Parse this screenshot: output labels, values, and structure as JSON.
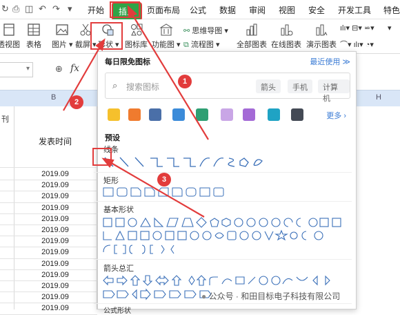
{
  "menu_tabs": [
    "开始",
    "插入",
    "页面布局",
    "公式",
    "数据",
    "审阅",
    "视图",
    "安全",
    "开发工具",
    "特色"
  ],
  "ribbon": {
    "left_cut": "透视图",
    "table": "表格",
    "picture": "图片",
    "screenshot": "截屏",
    "shape": "形状",
    "icon_lib": "图标库",
    "func_chart": "功能图",
    "mindmap": "思维导图",
    "flowchart": "流程图",
    "all_charts": "全部图表",
    "online_charts": "在线图表",
    "demo_charts": "演示图表"
  },
  "formula": {
    "fx": "fx"
  },
  "sheet": {
    "col_b": "B",
    "col_h": "H",
    "left_text": "刊",
    "header_cell": "发表时间",
    "dates": [
      "2019.09",
      "2019.09",
      "2019.09",
      "2019.09",
      "2019.09",
      "2019.09",
      "2019.09",
      "2019.09",
      "2019.09",
      "2019.09",
      "2019.09",
      "2019.09",
      "2019.09"
    ]
  },
  "dialog": {
    "title": "每日限免图标",
    "recent": "最近使用",
    "search_placeholder": "搜索图标",
    "chips": [
      "箭头",
      "手机",
      "计算机"
    ],
    "more": "更多",
    "preset": "预设",
    "lines": "线条",
    "rect": "矩形",
    "basic": "基本形状",
    "arrows": "箭头总汇",
    "formula_shapes": "公式形状"
  },
  "badges": [
    "1",
    "2",
    "3"
  ],
  "watermark": "公众号 · 和田目标电子科技有限公司"
}
